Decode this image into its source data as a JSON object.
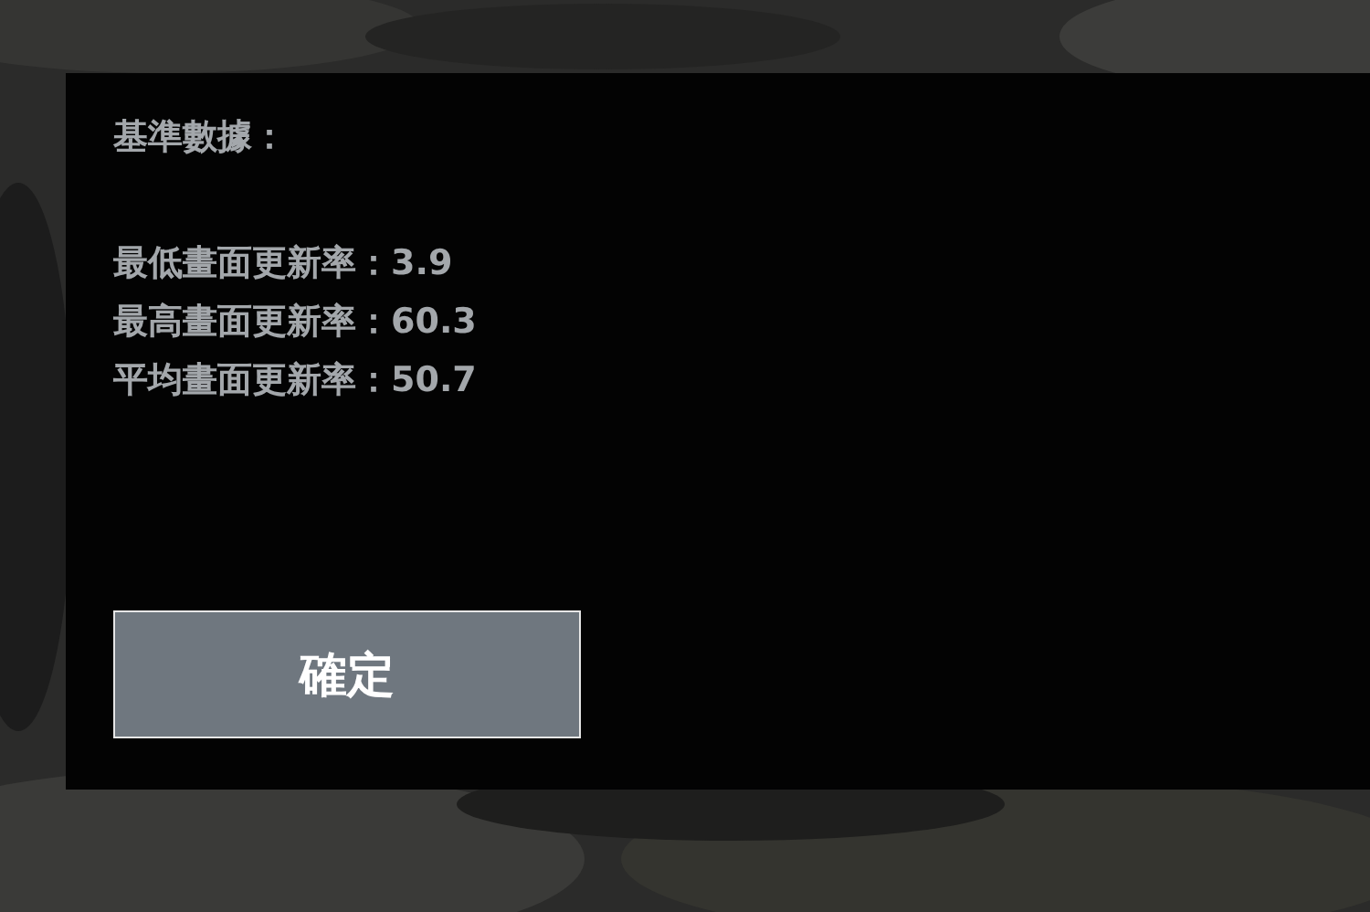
{
  "dialog": {
    "title": "基準數據：",
    "lines": [
      "最低畫面更新率：3.9",
      "最高畫面更新率：60.3",
      "平均畫面更新率：50.7"
    ],
    "button": "確定"
  }
}
